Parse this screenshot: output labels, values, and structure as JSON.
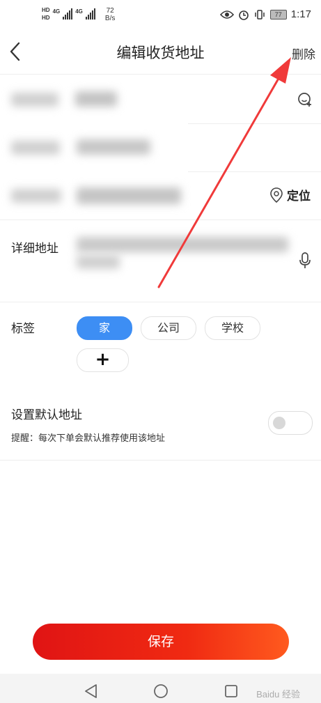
{
  "status_bar": {
    "hd1": "HD",
    "hd2": "HD",
    "net1": "4G",
    "net2": "4G",
    "speed_value": "72",
    "speed_unit": "B/s",
    "battery": "77",
    "time": "1:17"
  },
  "header": {
    "title": "编辑收货地址",
    "delete_label": "删除"
  },
  "form": {
    "detail_label": "详细地址",
    "locate_label": "定位",
    "tag_label": "标签",
    "tags": [
      "家",
      "公司",
      "学校"
    ],
    "add_tag_glyph": "+",
    "default_label": "设置默认地址",
    "default_hint": "提醒：每次下单会默认推荐使用该地址",
    "default_on": false
  },
  "save_label": "保存",
  "watermark": "Baidu 经验",
  "colors": {
    "accent_blue": "#3d8ef4",
    "save_start": "#e01414",
    "save_end": "#ff5a1e",
    "annotation_arrow": "#f03a3a"
  }
}
